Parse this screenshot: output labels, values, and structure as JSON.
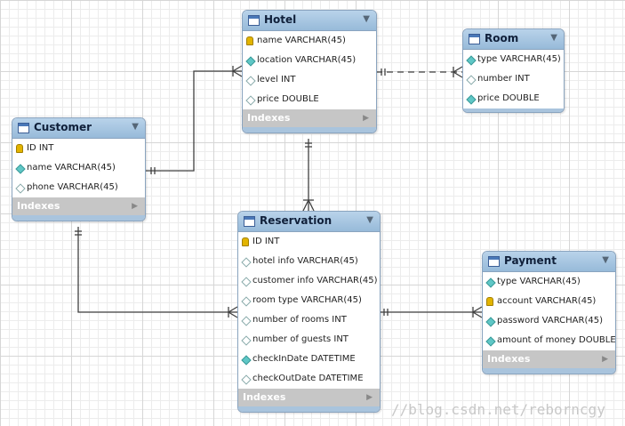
{
  "tables": {
    "hotel": {
      "name": "Hotel",
      "columns": [
        {
          "icon": "pk",
          "text": "name VARCHAR(45)"
        },
        {
          "icon": "nn",
          "text": "location VARCHAR(45)"
        },
        {
          "icon": "nl",
          "text": "level INT"
        },
        {
          "icon": "nl",
          "text": "price DOUBLE"
        }
      ],
      "indexes_label": "Indexes"
    },
    "room": {
      "name": "Room",
      "columns": [
        {
          "icon": "nn",
          "text": "type VARCHAR(45)"
        },
        {
          "icon": "nl",
          "text": "number INT"
        },
        {
          "icon": "nn",
          "text": "price DOUBLE"
        }
      ]
    },
    "customer": {
      "name": "Customer",
      "columns": [
        {
          "icon": "pk",
          "text": "ID INT"
        },
        {
          "icon": "nn",
          "text": "name VARCHAR(45)"
        },
        {
          "icon": "nl",
          "text": "phone VARCHAR(45)"
        }
      ],
      "indexes_label": "Indexes"
    },
    "reservation": {
      "name": "Reservation",
      "columns": [
        {
          "icon": "pk",
          "text": "ID INT"
        },
        {
          "icon": "nl",
          "text": "hotel info VARCHAR(45)"
        },
        {
          "icon": "nl",
          "text": "customer info VARCHAR(45)"
        },
        {
          "icon": "nl",
          "text": "room type VARCHAR(45)"
        },
        {
          "icon": "nl",
          "text": "number of rooms INT"
        },
        {
          "icon": "nl",
          "text": "number of guests INT"
        },
        {
          "icon": "nn",
          "text": "checkInDate DATETIME"
        },
        {
          "icon": "nl",
          "text": "checkOutDate DATETIME"
        }
      ],
      "indexes_label": "Indexes"
    },
    "payment": {
      "name": "Payment",
      "columns": [
        {
          "icon": "nn",
          "text": "type VARCHAR(45)"
        },
        {
          "icon": "pk",
          "text": "account VARCHAR(45)"
        },
        {
          "icon": "nn",
          "text": "password VARCHAR(45)"
        },
        {
          "icon": "nn",
          "text": "amount of money DOUBLE"
        }
      ],
      "indexes_label": "Indexes"
    }
  },
  "icons": {
    "table": "table-icon",
    "menu": "dropdown-arrow-icon",
    "pk": "primary-key-icon",
    "nn": "not-null-column-icon",
    "nl": "nullable-column-icon",
    "indexes": "expand-arrow-icon"
  },
  "relationships": [
    {
      "from": "customer",
      "to": "hotel",
      "style": "solid"
    },
    {
      "from": "hotel",
      "to": "room",
      "style": "dashed"
    },
    {
      "from": "hotel",
      "to": "reservation",
      "style": "solid"
    },
    {
      "from": "customer",
      "to": "reservation",
      "style": "solid"
    },
    {
      "from": "payment",
      "to": "reservation",
      "style": "solid"
    }
  ],
  "watermark": "//blog.csdn.net/reborncgy",
  "colors": {
    "header": "#a9c8e4",
    "indexes_bar": "#c6c6c6",
    "connector": "#404040",
    "primary_key": "#e2b400",
    "not_null": "#5fc7c6"
  }
}
